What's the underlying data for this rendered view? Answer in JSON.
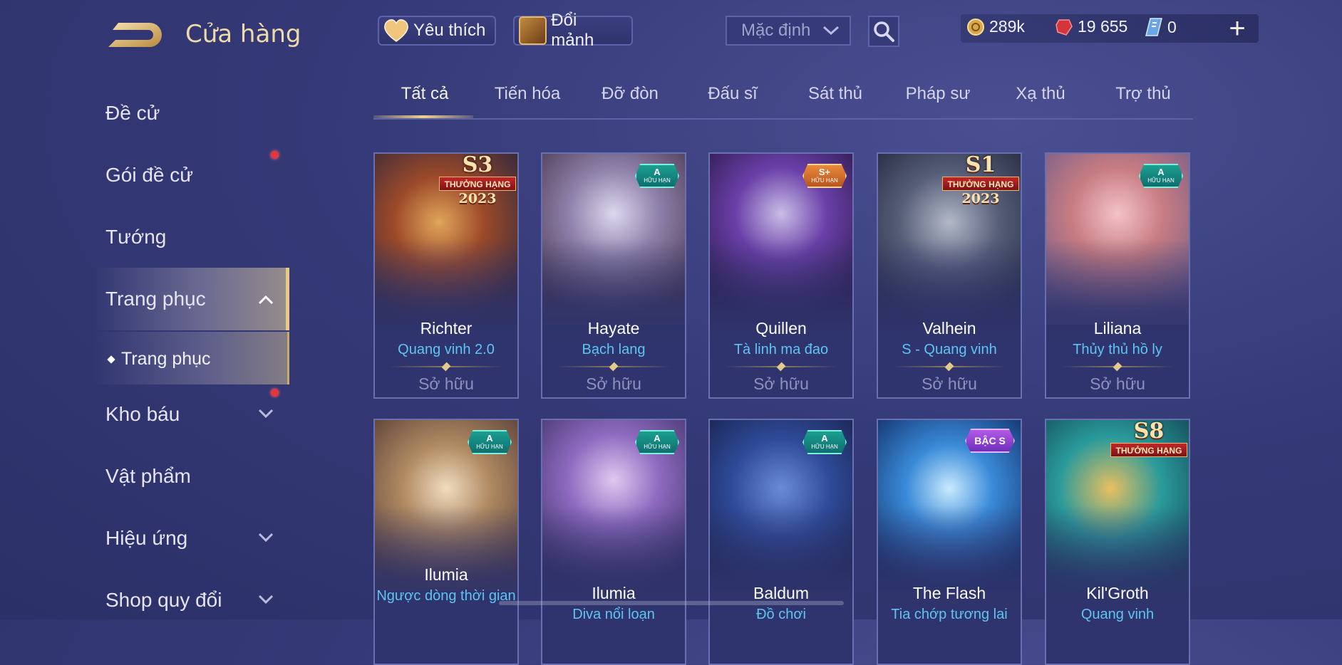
{
  "header": {
    "title": "Cửa hàng",
    "favorite_label": "Yêu thích",
    "fragment_label": "Đổi mảnh",
    "sort_value": "Mặc định",
    "currency": [
      {
        "icon": "gold-coin-icon",
        "value": "289k"
      },
      {
        "icon": "voucher-gem-icon",
        "value": "19 655"
      },
      {
        "icon": "ticket-icon",
        "value": "0"
      }
    ],
    "plus_label": "+"
  },
  "sidebar": {
    "items": [
      {
        "label": "Đề cử"
      },
      {
        "label": "Gói đề cử"
      },
      {
        "label": "Tướng"
      },
      {
        "label": "Trang phục"
      },
      {
        "label": "Trang phục"
      },
      {
        "label": "Kho báu"
      },
      {
        "label": "Vật phẩm"
      },
      {
        "label": "Hiệu ứng"
      },
      {
        "label": "Shop quy đổi"
      }
    ]
  },
  "tabs": [
    "Tất cả",
    "Tiến hóa",
    "Đỡ đòn",
    "Đấu sĩ",
    "Sát thủ",
    "Pháp sư",
    "Xạ thủ",
    "Trợ thủ"
  ],
  "cards": [
    {
      "hero": "Richter",
      "skin": "Quang vinh 2.0",
      "status": "Sở hữu",
      "badge": "S3",
      "ribbon": "THƯỞNG HẠNG",
      "year": "2023"
    },
    {
      "hero": "Hayate",
      "skin": "Bạch lang",
      "status": "Sở hữu",
      "badge": "A",
      "badge_sub": "HỮU HẠN"
    },
    {
      "hero": "Quillen",
      "skin": "Tà linh ma đao",
      "status": "Sở hữu",
      "badge": "S+",
      "badge_sub": "HỮU HẠN"
    },
    {
      "hero": "Valhein",
      "skin": "S - Quang vinh",
      "status": "Sở hữu",
      "badge": "S1",
      "ribbon": "THƯỞNG HẠNG",
      "year": "2023"
    },
    {
      "hero": "Liliana",
      "skin": "Thủy thủ hồ ly",
      "status": "Sở hữu",
      "badge": "A",
      "badge_sub": "HỮU HẠN"
    },
    {
      "hero": "Ilumia",
      "skin": "Ngược dòng thời gian",
      "badge": "A",
      "badge_sub": "HỮU HẠN"
    },
    {
      "hero": "Ilumia",
      "skin": "Diva nổi loạn",
      "badge": "A",
      "badge_sub": "HỮU HẠN"
    },
    {
      "hero": "Baldum",
      "skin": "Đồ chơi",
      "badge": "A",
      "badge_sub": "HỮU HẠN"
    },
    {
      "hero": "The Flash",
      "skin": "Tia chớp tương lai",
      "badge": "BẬC S"
    },
    {
      "hero": "Kil'Groth",
      "skin": "Quang vinh",
      "badge": "S8",
      "ribbon": "THƯỞNG HẠNG"
    }
  ],
  "colors": {
    "accent_gold": "#e8c887",
    "skin_name": "#5ec4f2",
    "notification": "#e53640"
  }
}
